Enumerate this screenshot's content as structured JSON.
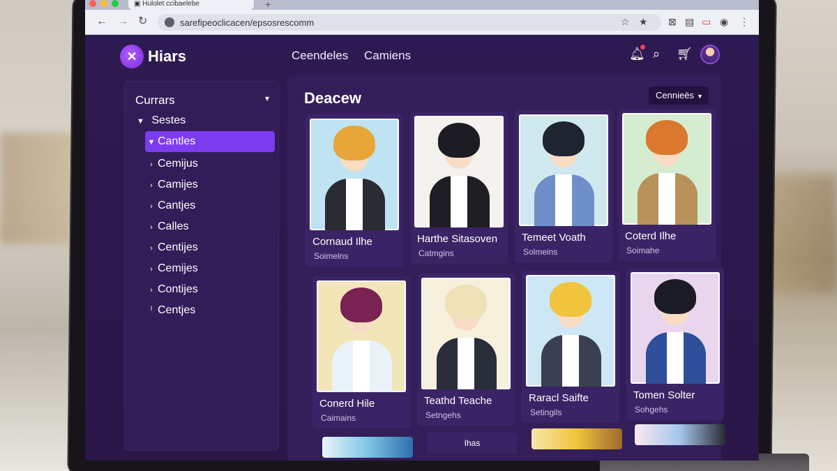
{
  "browser": {
    "tab_title": "Hulolet ccibaelebe",
    "url": "sarefipeoclicacen/epsosrescomm"
  },
  "header": {
    "logo_text": "Hiars",
    "nav": [
      "Ceendeles",
      "Camiens"
    ]
  },
  "sidebar": {
    "header": "Currars",
    "group": "Sestes",
    "items": [
      {
        "label": "Cantles",
        "active": true
      },
      {
        "label": "Cemijus"
      },
      {
        "label": "Camijes"
      },
      {
        "label": "Cantjes"
      },
      {
        "label": "Calles"
      },
      {
        "label": "Centijes"
      },
      {
        "label": "Cemijes"
      },
      {
        "label": "Contijes"
      },
      {
        "label": "Centjes"
      }
    ]
  },
  "main": {
    "title": "Deacew",
    "sort_label": "Cennieës",
    "cards": [
      {
        "title": "Cornaud Ilhe",
        "subtitle": "Soimelns",
        "hair": "#e8a63a",
        "body": "#2b2b33",
        "bg": "#bfe3f2"
      },
      {
        "title": "Harthe Sitasoven",
        "subtitle": "Catmgins",
        "hair": "#1c1c22",
        "body": "#1e1e24",
        "bg": "#f4f1ee"
      },
      {
        "title": "Temeet Voath",
        "subtitle": "Solmeins",
        "hair": "#1f2430",
        "body": "#6e8fc8",
        "bg": "#cfe9ee"
      },
      {
        "title": "Coterd Ilhe",
        "subtitle": "Soimahe",
        "hair": "#d9782e",
        "body": "#b8925a",
        "bg": "#d5ecd0"
      },
      {
        "title": "Conerd Hile",
        "subtitle": "Caimains",
        "hair": "#7a2252",
        "body": "#e9f2f8",
        "bg": "#f2e6b8"
      },
      {
        "title": "Teathd Teache",
        "subtitle": "Setngehs",
        "hair": "#efe1b8",
        "body": "#2a2d3a",
        "bg": "#f6f0dc"
      },
      {
        "title": "Raracl Saifte",
        "subtitle": "Setingils",
        "hair": "#f0c43c",
        "body": "#3a3f52",
        "bg": "#cde8f4"
      },
      {
        "title": "Tomen Solter",
        "subtitle": "Sohgehs",
        "hair": "#1b1b25",
        "body": "#2f4f9a",
        "bg": "#e9d6ee"
      }
    ],
    "partial_label": "Ihas"
  }
}
